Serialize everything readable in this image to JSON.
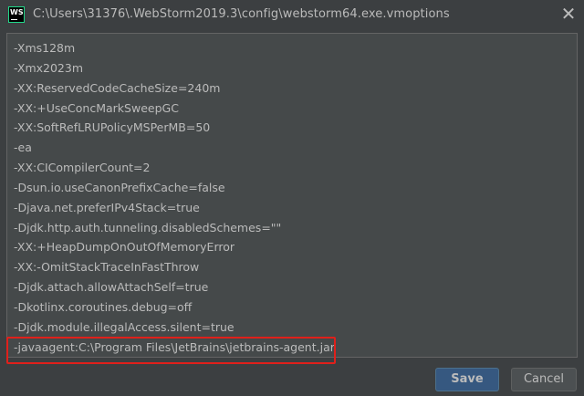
{
  "window": {
    "title": "C:\\Users\\31376\\.WebStorm2019.3\\config\\webstorm64.exe.vmoptions",
    "app_icon_label": "WS",
    "close_glyph": "✕"
  },
  "editor": {
    "lines": [
      "-Xms128m",
      "-Xmx2023m",
      "-XX:ReservedCodeCacheSize=240m",
      "-XX:+UseConcMarkSweepGC",
      "-XX:SoftRefLRUPolicyMSPerMB=50",
      "-ea",
      "-XX:CICompilerCount=2",
      "-Dsun.io.useCanonPrefixCache=false",
      "-Djava.net.preferIPv4Stack=true",
      "-Djdk.http.auth.tunneling.disabledSchemes=\"\"",
      "-XX:+HeapDumpOnOutOfMemoryError",
      "-XX:-OmitStackTraceInFastThrow",
      "-Djdk.attach.allowAttachSelf=true",
      "-Dkotlinx.coroutines.debug=off",
      "-Djdk.module.illegalAccess.silent=true",
      "-javaagent:C:\\Program Files\\JetBrains\\jetbrains-agent.jar"
    ],
    "highlight_color": "#e0201b"
  },
  "buttons": {
    "save_label": "Save",
    "cancel_label": "Cancel"
  },
  "colors": {
    "background": "#3c3f41",
    "editor_background": "#45494a",
    "text": "#bbbbbb",
    "primary_button": "#365880"
  }
}
